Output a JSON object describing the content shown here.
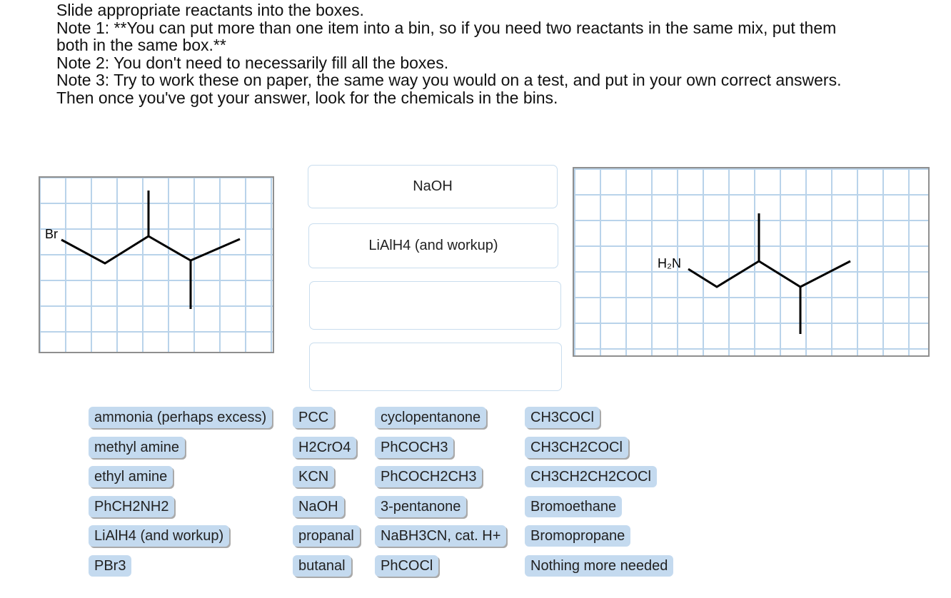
{
  "instructions": {
    "line1": "Slide appropriate reactants into the boxes.",
    "line2": "Note 1:  **You can put more than one item into a bin, so if you need two reactants in the same mix, put them",
    "line3": "both in the same box.**",
    "line4": "Note 2:  You don't need to necessarily fill all the boxes.",
    "line5": "Note 3:  Try to work these on paper, the same way you would on a test, and put in your own correct answers.",
    "line6": "Then once you've got your answer, look for the chemicals in the bins."
  },
  "starting_material": {
    "atom_label": "Br"
  },
  "product": {
    "atom_label": "H₂N"
  },
  "drop_boxes": [
    {
      "content": "NaOH"
    },
    {
      "content": "LiAlH4 (and workup)"
    },
    {
      "content": ""
    },
    {
      "content": ""
    }
  ],
  "reagent_bank": {
    "col1": [
      "ammonia (perhaps excess)",
      "methyl amine",
      "ethyl amine",
      "PhCH2NH2",
      "LiAlH4 (and workup)",
      "PBr3"
    ],
    "col2": [
      "PCC",
      "H2CrO4",
      "KCN",
      "NaOH",
      "propanal",
      "butanal"
    ],
    "col3": [
      "cyclopentanone",
      "PhCOCH3",
      "PhCOCH2CH3",
      "3-pentanone",
      "NaBH3CN, cat. H+",
      "PhCOCl"
    ],
    "col4": [
      "CH3COCl",
      "CH3CH2COCl",
      "CH3CH2CH2COCl",
      "Bromoethane",
      "Bromopropane",
      "Nothing more needed"
    ]
  },
  "colors": {
    "chip_bg": "#c4daef",
    "grid_line": "#b9d3ea",
    "panel_border": "#8f8f8f",
    "drop_border": "#c9ddee"
  }
}
